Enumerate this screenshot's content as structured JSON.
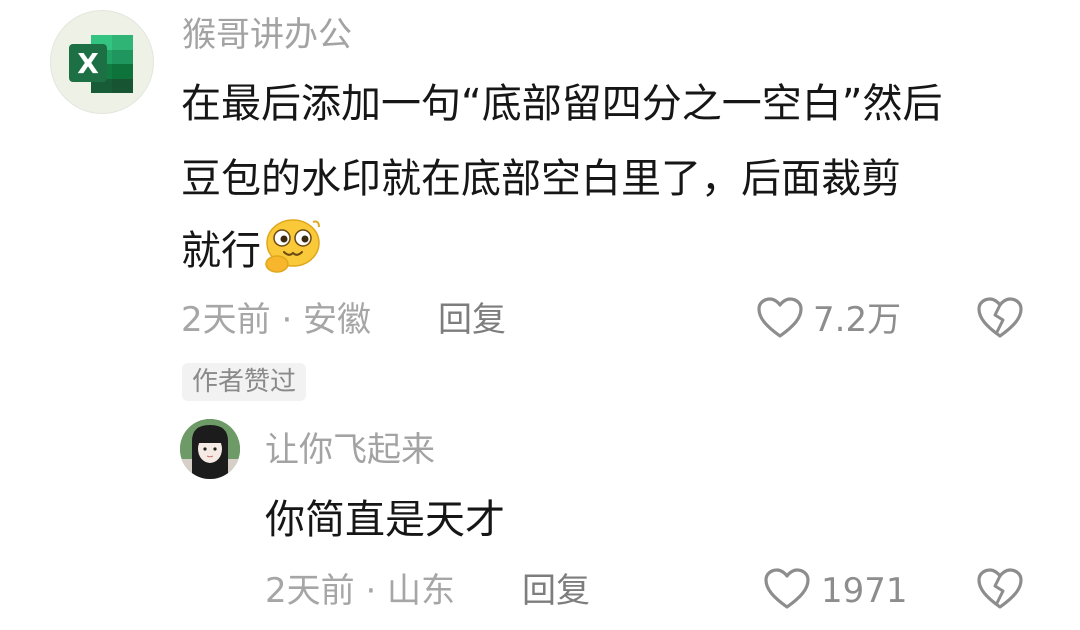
{
  "comment": {
    "avatar_icon": "excel-logo-icon",
    "author": "猴哥讲办公",
    "text_lines": [
      "在最后添加一句“底部留四分之一空白”然后",
      "豆包的水印就在底部空白里了，后面裁剪",
      "就行"
    ],
    "emoji_icon": "smirk-face-emoji-icon",
    "time_location": "2天前 · 安徽",
    "reply_label": "回复",
    "like_count": "7.2万",
    "author_liked_badge": "作者赞过"
  },
  "reply": {
    "avatar_icon": "anime-girl-avatar-icon",
    "author": "让你飞起来",
    "text": "你简直是天才",
    "time_location": "2天前 · 山东",
    "reply_label": "回复",
    "like_count": "1971"
  },
  "colors": {
    "text": "#161616",
    "meta": "#a6a6a6",
    "excel_green": "#1d7044"
  }
}
